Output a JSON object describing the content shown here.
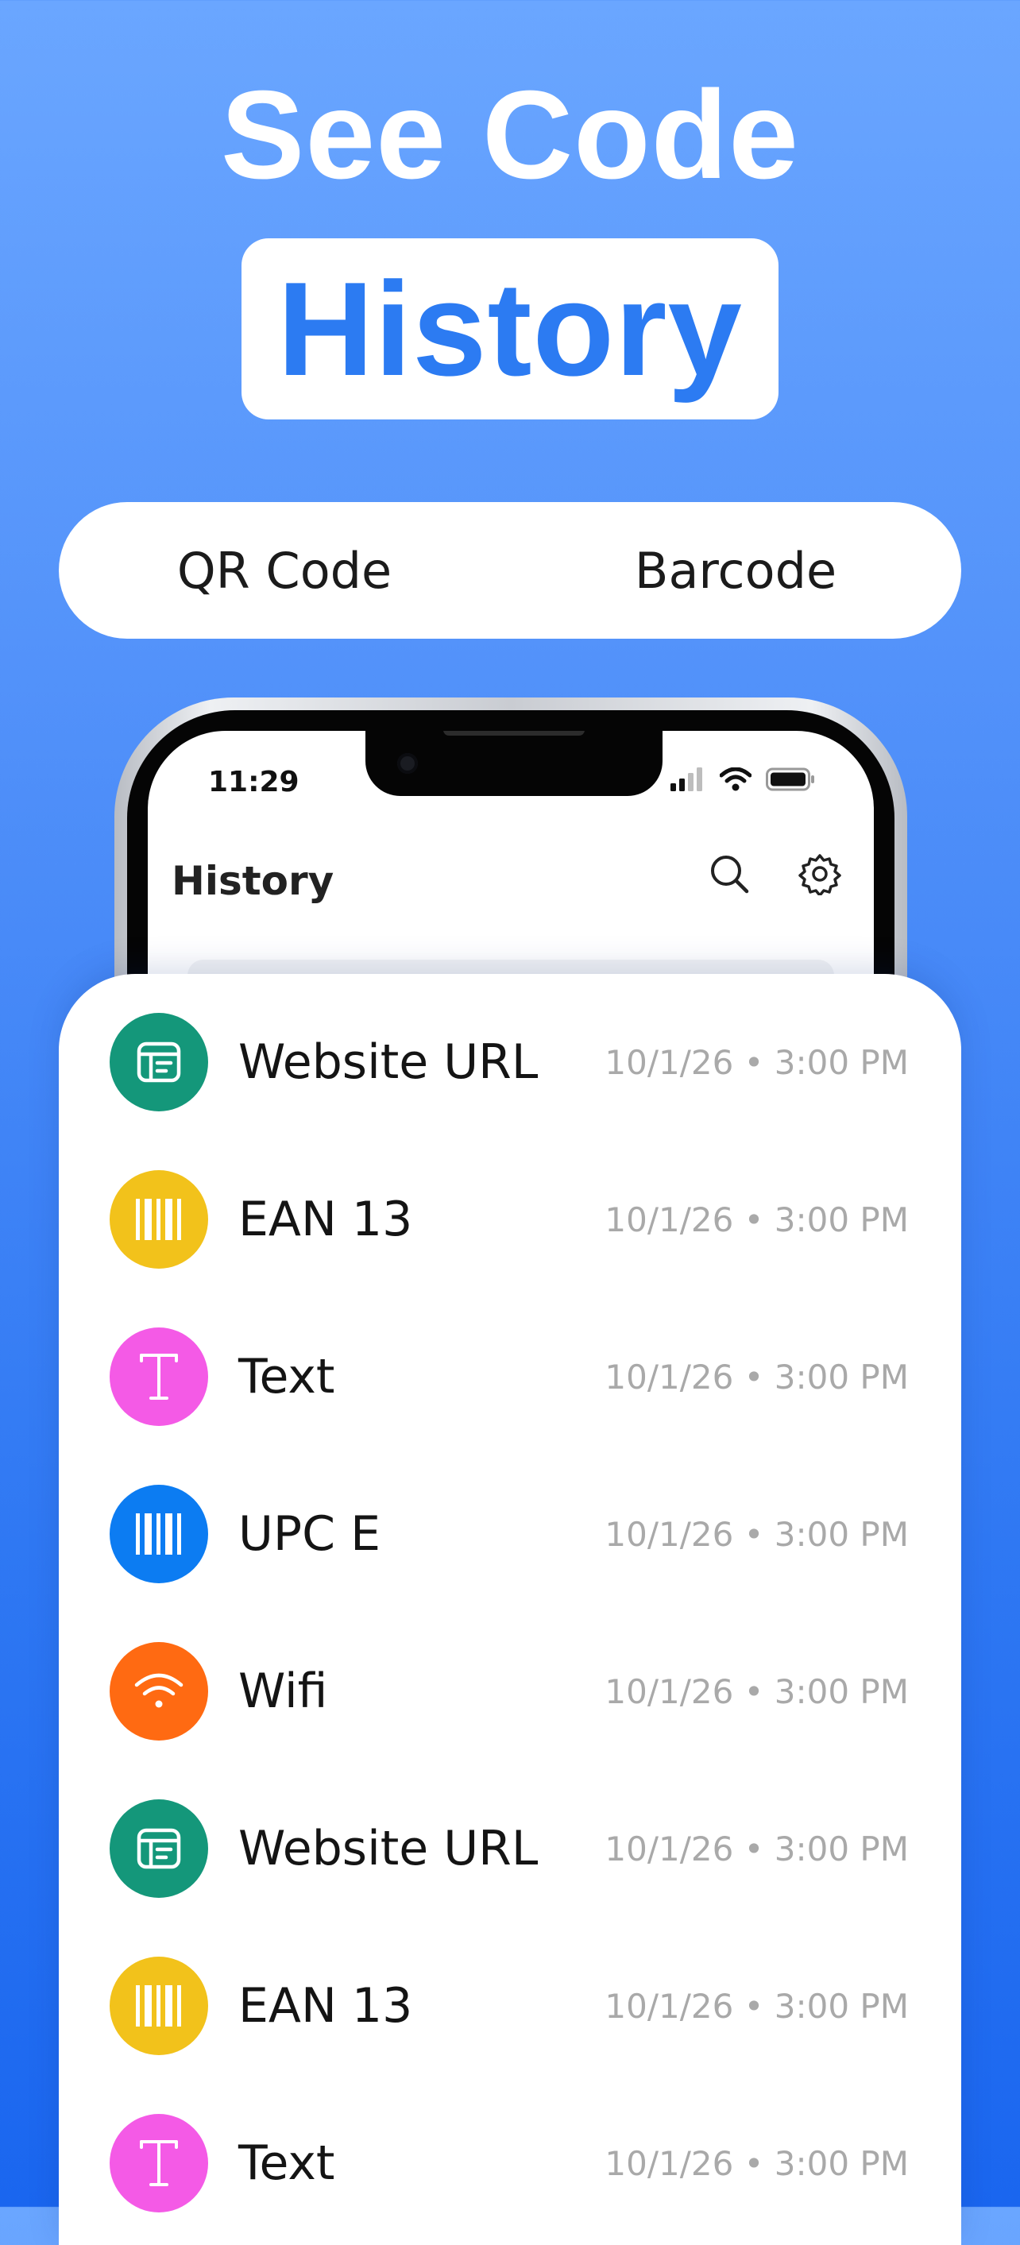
{
  "headline": {
    "line1": "See Code",
    "line2": "History"
  },
  "tabs": [
    {
      "label": "QR Code"
    },
    {
      "label": "Barcode"
    }
  ],
  "phone": {
    "status_time": "11:29",
    "title": "History",
    "actions": [
      "search-icon",
      "gear-icon"
    ]
  },
  "history": [
    {
      "label": "Website URL",
      "date": "10/1/26 • 3:00 PM",
      "icon": "website-icon",
      "color": "#14977a"
    },
    {
      "label": "EAN 13",
      "date": "10/1/26 • 3:00 PM",
      "icon": "barcode-icon",
      "color": "#f2c21b"
    },
    {
      "label": "Text",
      "date": "10/1/26 • 3:00 PM",
      "icon": "text-icon",
      "color": "#f45ae6"
    },
    {
      "label": "UPC E",
      "date": "10/1/26 • 3:00 PM",
      "icon": "barcode-icon",
      "color": "#0c7cf2"
    },
    {
      "label": "Wifi",
      "date": "10/1/26 • 3:00 PM",
      "icon": "wifi-icon",
      "color": "#ff6a12"
    },
    {
      "label": "Website URL",
      "date": "10/1/26 • 3:00 PM",
      "icon": "website-icon",
      "color": "#14977a"
    },
    {
      "label": "EAN 13",
      "date": "10/1/26 • 3:00 PM",
      "icon": "barcode-icon",
      "color": "#f2c21b"
    },
    {
      "label": "Text",
      "date": "10/1/26 • 3:00 PM",
      "icon": "text-icon",
      "color": "#f45ae6"
    }
  ]
}
